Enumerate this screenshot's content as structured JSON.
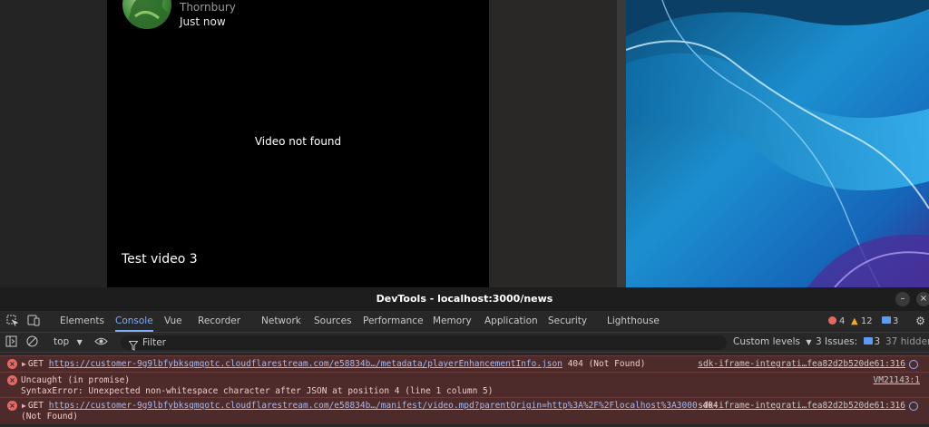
{
  "app": {
    "author": "Thornbury",
    "timestamp": "Just now",
    "video_message": "Video not found",
    "video_title": "Test video 3"
  },
  "devtools": {
    "window_title": "DevTools - localhost:3000/news",
    "tabs": [
      {
        "label": "Elements"
      },
      {
        "label": "Console",
        "active": true
      },
      {
        "label": "Vue"
      },
      {
        "label": "Recorder"
      },
      {
        "label": "Network"
      },
      {
        "label": "Sources"
      },
      {
        "label": "Performance"
      },
      {
        "label": "Memory"
      },
      {
        "label": "Application"
      },
      {
        "label": "Security"
      },
      {
        "label": "Lighthouse"
      }
    ],
    "counts": {
      "errors": "4",
      "warnings": "12",
      "messages": "3"
    },
    "toolbar": {
      "context": "top",
      "filter_placeholder": "Filter",
      "levels": "Custom levels",
      "issues_label": "3 Issues:",
      "issues_count": "3",
      "hidden": "37 hidden"
    },
    "messages": [
      {
        "method": "GET",
        "url": "https://customer-9g9lbfybksgmqotc.cloudflarestream.com/e58834b…/metadata/playerEnhancementInfo.json",
        "status": "404 (Not Found)",
        "source": "sdk-iframe-integrati…fea82d2b520de61:316"
      },
      {
        "line1": "Uncaught (in promise)",
        "line2": "SyntaxError: Unexpected non-whitespace character after JSON at position 4 (line 1 column 5)",
        "source": "VM21143:1"
      },
      {
        "method": "GET",
        "url": "https://customer-9g9lbfybksgmqotc.cloudflarestream.com/e58834b…/manifest/video.mpd?parentOrigin=http%3A%2F%2Flocalhost%3A3000",
        "status": "404",
        "status2": "(Not Found)",
        "source": "sdk-iframe-integrati…fea82d2b520de61:316"
      }
    ]
  },
  "colors": {
    "accent": "#7cacf8",
    "error_bg": "#4e2b2b",
    "error_icon": "#e46962",
    "warning_icon": "#f5a623",
    "info_icon": "#5e9bf0"
  }
}
